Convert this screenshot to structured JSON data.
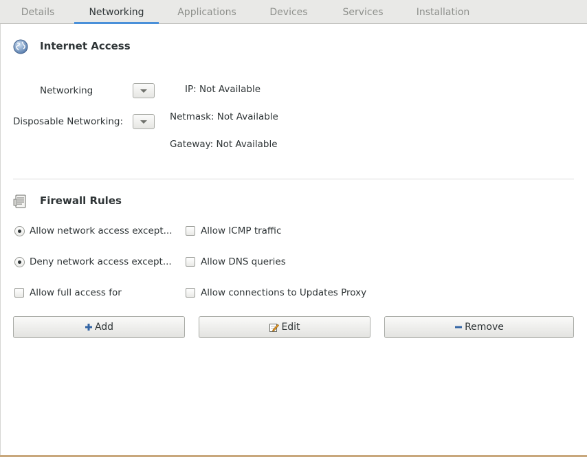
{
  "tabs": [
    {
      "label": "Details"
    },
    {
      "label": "Networking"
    },
    {
      "label": "Applications"
    },
    {
      "label": "Devices"
    },
    {
      "label": "Services"
    },
    {
      "label": "Installation"
    }
  ],
  "active_tab": "Networking",
  "internet_access": {
    "title": "Internet Access",
    "icon": "globe-icon",
    "networking_label": "Networking",
    "disposable_label": "Disposable Networking:",
    "ip": "IP: Not Available",
    "netmask": "Netmask: Not Available",
    "gateway": "Gateway: Not Available"
  },
  "firewall": {
    "title": "Firewall Rules",
    "icon": "firewall-document-icon",
    "allow_except": "Allow network access except...",
    "deny_except": "Deny network access except...",
    "allow_full": "Allow full access for",
    "allow_icmp": "Allow ICMP traffic",
    "allow_dns": "Allow DNS queries",
    "allow_updates": "Allow connections to Updates Proxy"
  },
  "buttons": {
    "add": "Add",
    "edit": "Edit",
    "remove": "Remove"
  },
  "colors": {
    "active_tab_underline": "#4a90d9",
    "add_icon": "#3465a4",
    "remove_icon": "#3465a4"
  }
}
